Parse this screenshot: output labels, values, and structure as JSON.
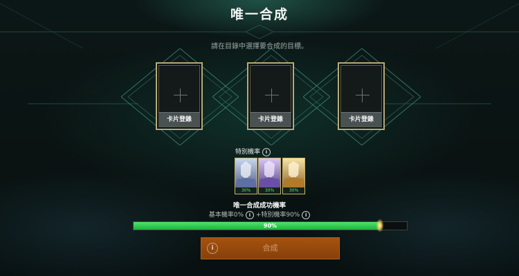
{
  "title": "唯一合成",
  "subtitle": "請在目錄中選擇要合成的目標。",
  "slots": [
    {
      "button_label": "卡片登錄"
    },
    {
      "button_label": "卡片登錄"
    },
    {
      "button_label": "卡片登錄"
    }
  ],
  "special_rate": {
    "label": "特別機率",
    "info_icon": "i",
    "heroes": [
      {
        "percent": "30%",
        "color": "#8a9ec4"
      },
      {
        "percent": "30%",
        "color": "#a98fcf"
      },
      {
        "percent": "30%",
        "color": "#d7a84a"
      }
    ]
  },
  "success_rate": {
    "label": "唯一合成成功機率",
    "base_text": "基本機率0%",
    "special_text": "+特別機率90%",
    "info_icon": "i",
    "bar_value": 0.9,
    "bar_label": "90%"
  },
  "fuse_button": {
    "info_icon": "i",
    "label": "合成"
  },
  "colors": {
    "accent_gold": "#b9aa78",
    "bar_green": "#2fc94f",
    "button_orange": "#a6500d"
  }
}
